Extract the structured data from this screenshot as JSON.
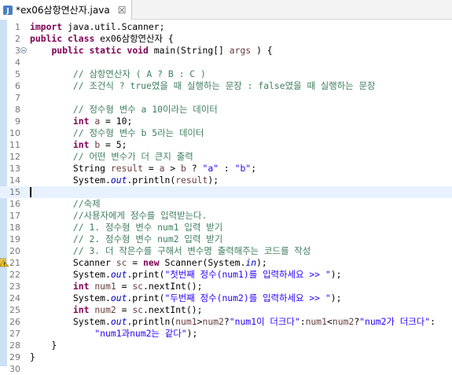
{
  "tab": {
    "title": "*ex06삼항연산자.java",
    "close_glyph": "☒"
  },
  "lines": [
    {
      "n": "1",
      "t": [
        [
          "kw",
          "import"
        ],
        [
          "",
          " java.util.Scanner;"
        ]
      ]
    },
    {
      "n": "2",
      "t": [
        [
          "kw",
          "public"
        ],
        [
          "",
          " "
        ],
        [
          "kw",
          "class"
        ],
        [
          "",
          " ex06삼항연산자 {"
        ]
      ]
    },
    {
      "n": "3",
      "fold": true,
      "t": [
        [
          "",
          "    "
        ],
        [
          "kw",
          "public"
        ],
        [
          "",
          " "
        ],
        [
          "kw",
          "static"
        ],
        [
          "",
          " "
        ],
        [
          "kw",
          "void"
        ],
        [
          "",
          " main(String[] "
        ],
        [
          "va",
          "args"
        ],
        [
          "",
          " ) {"
        ]
      ]
    },
    {
      "n": "4",
      "t": []
    },
    {
      "n": "5",
      "t": [
        [
          "",
          "        "
        ],
        [
          "cm",
          "// 삼항연산자 ( A ? B : C )"
        ]
      ]
    },
    {
      "n": "6",
      "t": [
        [
          "",
          "        "
        ],
        [
          "cm",
          "// 조건식 ? true였을 때 실행하는 문장 : false였을 때 실행하는 문장"
        ]
      ]
    },
    {
      "n": "7",
      "t": []
    },
    {
      "n": "8",
      "t": [
        [
          "",
          "        "
        ],
        [
          "cm",
          "// 정수형 변수 a 10이라는 데이터"
        ]
      ]
    },
    {
      "n": "9",
      "t": [
        [
          "",
          "        "
        ],
        [
          "kw",
          "int"
        ],
        [
          "",
          " "
        ],
        [
          "va",
          "a"
        ],
        [
          "",
          " = 10;"
        ]
      ]
    },
    {
      "n": "10",
      "t": [
        [
          "",
          "        "
        ],
        [
          "cm",
          "// 정수형 변수 b 5라는 데이터"
        ]
      ]
    },
    {
      "n": "11",
      "t": [
        [
          "",
          "        "
        ],
        [
          "kw",
          "int"
        ],
        [
          "",
          " "
        ],
        [
          "va",
          "b"
        ],
        [
          "",
          " = 5;"
        ]
      ]
    },
    {
      "n": "12",
      "t": [
        [
          "",
          "        "
        ],
        [
          "cm",
          "// 어떤 변수가 더 큰지 출력"
        ]
      ]
    },
    {
      "n": "13",
      "t": [
        [
          "",
          "        String "
        ],
        [
          "va",
          "result"
        ],
        [
          "",
          " = "
        ],
        [
          "va",
          "a"
        ],
        [
          "",
          " > "
        ],
        [
          "va",
          "b"
        ],
        [
          "",
          " ? "
        ],
        [
          "st",
          "\"a\""
        ],
        [
          "",
          " : "
        ],
        [
          "st",
          "\"b\""
        ],
        [
          "",
          ";"
        ]
      ]
    },
    {
      "n": "14",
      "t": [
        [
          "",
          "        System."
        ],
        [
          "fi",
          "out"
        ],
        [
          "",
          ".println("
        ],
        [
          "va",
          "result"
        ],
        [
          "",
          ");"
        ]
      ]
    },
    {
      "n": "15",
      "active": true,
      "caret": true,
      "t": []
    },
    {
      "n": "16",
      "t": [
        [
          "",
          "        "
        ],
        [
          "cm",
          "//숙제"
        ]
      ]
    },
    {
      "n": "17",
      "t": [
        [
          "",
          "        "
        ],
        [
          "cm",
          "//사용자에게 정수를 입력받는다."
        ]
      ]
    },
    {
      "n": "18",
      "t": [
        [
          "",
          "        "
        ],
        [
          "cm",
          "// 1. 정수형 변수 num1 입력 받기"
        ]
      ]
    },
    {
      "n": "19",
      "t": [
        [
          "",
          "        "
        ],
        [
          "cm",
          "// 2. 정수형 변수 num2 입력 받기"
        ]
      ]
    },
    {
      "n": "20",
      "t": [
        [
          "",
          "        "
        ],
        [
          "cm",
          "// 3. 더 작은수를 구해서 변수명 출력해주는 코드를 작성"
        ]
      ]
    },
    {
      "n": "21",
      "warn": true,
      "t": [
        [
          "",
          "        Scanner "
        ],
        [
          "va",
          "sc"
        ],
        [
          "",
          " = "
        ],
        [
          "kw",
          "new"
        ],
        [
          "",
          " Scanner(System."
        ],
        [
          "fi",
          "in"
        ],
        [
          "",
          ");"
        ]
      ]
    },
    {
      "n": "22",
      "t": [
        [
          "",
          "        System."
        ],
        [
          "fi",
          "out"
        ],
        [
          "",
          ".print("
        ],
        [
          "st",
          "\"첫번째 정수(num1)를 입력하세요 >> \""
        ],
        [
          "",
          ");"
        ]
      ]
    },
    {
      "n": "23",
      "t": [
        [
          "",
          "        "
        ],
        [
          "kw",
          "int"
        ],
        [
          "",
          " "
        ],
        [
          "va",
          "num1"
        ],
        [
          "",
          " = "
        ],
        [
          "va",
          "sc"
        ],
        [
          "",
          ".nextInt();"
        ]
      ]
    },
    {
      "n": "24",
      "t": [
        [
          "",
          "        System."
        ],
        [
          "fi",
          "out"
        ],
        [
          "",
          ".print("
        ],
        [
          "st",
          "\"두번째 정수(num2)를 입력하세요 >> \""
        ],
        [
          "",
          ");"
        ]
      ]
    },
    {
      "n": "25",
      "t": [
        [
          "",
          "        "
        ],
        [
          "kw",
          "int"
        ],
        [
          "",
          " "
        ],
        [
          "va",
          "num2"
        ],
        [
          "",
          " = "
        ],
        [
          "va",
          "sc"
        ],
        [
          "",
          ".nextInt();"
        ]
      ]
    },
    {
      "n": "26",
      "t": [
        [
          "",
          "        System."
        ],
        [
          "fi",
          "out"
        ],
        [
          "",
          ".println("
        ],
        [
          "va",
          "num1"
        ],
        [
          "",
          ">"
        ],
        [
          "va",
          "num2"
        ],
        [
          "",
          "?"
        ],
        [
          "st",
          "\"num1이 더크다\""
        ],
        [
          "",
          ":"
        ],
        [
          "va",
          "num1"
        ],
        [
          "",
          "<"
        ],
        [
          "va",
          "num2"
        ],
        [
          "",
          "?"
        ],
        [
          "st",
          "\"num2가 더크다\""
        ],
        [
          "",
          ":"
        ]
      ]
    },
    {
      "n": "27",
      "t": [
        [
          "",
          "            "
        ],
        [
          "st",
          "\"num1과num2는 같다\""
        ],
        [
          "",
          ");"
        ]
      ]
    },
    {
      "n": "28",
      "t": [
        [
          "",
          "    }"
        ]
      ]
    },
    {
      "n": "29",
      "t": [
        [
          "",
          "}"
        ]
      ]
    },
    {
      "n": "30",
      "t": []
    }
  ],
  "colors": {
    "keyword": "#7f0055",
    "comment": "#3f7f5f",
    "string": "#2a00ff",
    "variable": "#6a3e3e",
    "field": "#0000c0",
    "active_line": "#e8f2fe"
  }
}
